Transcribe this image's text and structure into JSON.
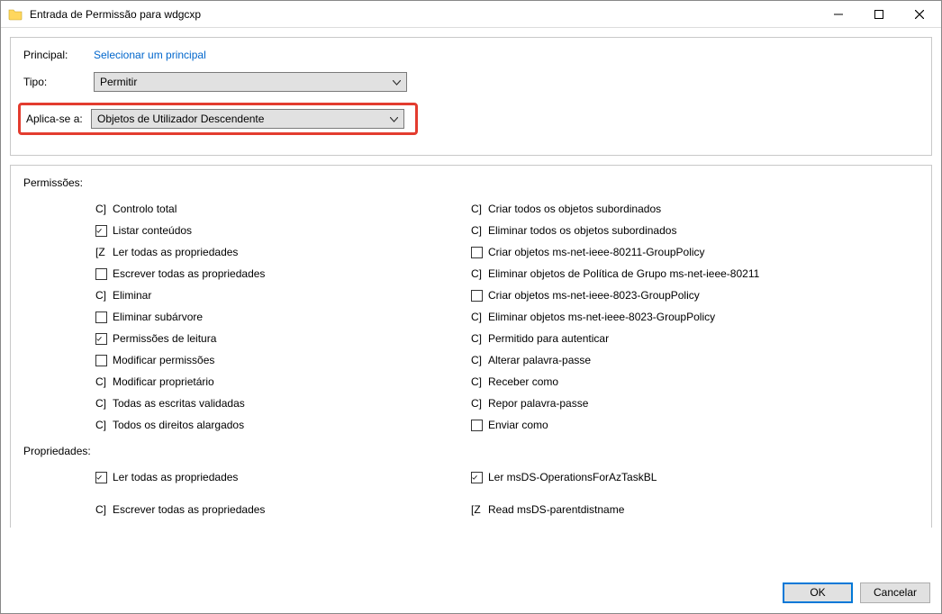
{
  "window": {
    "title": "Entrada de Permissão para wdgcxp"
  },
  "form": {
    "principal_label": "Principal:",
    "principal_link": "Selecionar um principal",
    "type_label": "Tipo:",
    "type_value": "Permitir",
    "applies_label": "Aplica-se a:",
    "applies_value": "Objetos de Utilizador Descendente"
  },
  "permissions": {
    "section_label": "Permissões:",
    "left": [
      {
        "kind": "glyph",
        "glyph": "C]",
        "label": "Controlo total"
      },
      {
        "kind": "check",
        "checked": true,
        "label": "Listar conteúdos"
      },
      {
        "kind": "glyph",
        "glyph": "[Z",
        "label": "Ler todas as propriedades"
      },
      {
        "kind": "check",
        "checked": false,
        "label": "Escrever todas as propriedades"
      },
      {
        "kind": "glyph",
        "glyph": "C]",
        "label": "Eliminar"
      },
      {
        "kind": "check",
        "checked": false,
        "label": "Eliminar subárvore"
      },
      {
        "kind": "check",
        "checked": true,
        "label": "Permissões de leitura"
      },
      {
        "kind": "check",
        "checked": false,
        "label": "Modificar permissões"
      },
      {
        "kind": "glyph",
        "glyph": "C]",
        "label": "Modificar proprietário"
      },
      {
        "kind": "glyph",
        "glyph": "C]",
        "label": "Todas as escritas validadas"
      },
      {
        "kind": "glyph",
        "glyph": "C]",
        "label": "Todos os direitos alargados"
      }
    ],
    "right": [
      {
        "kind": "glyph",
        "glyph": "C]",
        "label": "Criar todos os objetos subordinados"
      },
      {
        "kind": "glyph",
        "glyph": "C]",
        "label": "Eliminar todos os objetos subordinados"
      },
      {
        "kind": "check",
        "checked": false,
        "label": "Criar objetos ms-net-ieee-80211-GroupPolicy"
      },
      {
        "kind": "glyph",
        "glyph": "C]",
        "label": "Eliminar objetos de Política de Grupo ms-net-ieee-80211"
      },
      {
        "kind": "check",
        "checked": false,
        "label": "Criar objetos ms-net-ieee-8023-GroupPolicy"
      },
      {
        "kind": "glyph",
        "glyph": "C]",
        "label": "Eliminar objetos ms-net-ieee-8023-GroupPolicy"
      },
      {
        "kind": "glyph",
        "glyph": "C]",
        "label": "Permitido para autenticar"
      },
      {
        "kind": "glyph",
        "glyph": "C]",
        "label": "Alterar palavra-passe"
      },
      {
        "kind": "glyph",
        "glyph": "C]",
        "label": "Receber como"
      },
      {
        "kind": "glyph",
        "glyph": "C]",
        "label": "Repor palavra-passe"
      },
      {
        "kind": "check",
        "checked": false,
        "label": "Enviar como"
      }
    ]
  },
  "properties": {
    "section_label": "Propriedades:",
    "left": [
      {
        "kind": "check",
        "checked": true,
        "label": "Ler todas as propriedades"
      },
      {
        "kind": "glyph",
        "glyph": "C]",
        "label": "Escrever todas as propriedades"
      }
    ],
    "right": [
      {
        "kind": "check",
        "checked": true,
        "label": "Ler msDS-OperationsForAzTaskBL"
      },
      {
        "kind": "glyph",
        "glyph": "[Z",
        "label": "Read msDS-parentdistname"
      }
    ]
  },
  "buttons": {
    "ok": "OK",
    "cancel": "Cancelar"
  }
}
